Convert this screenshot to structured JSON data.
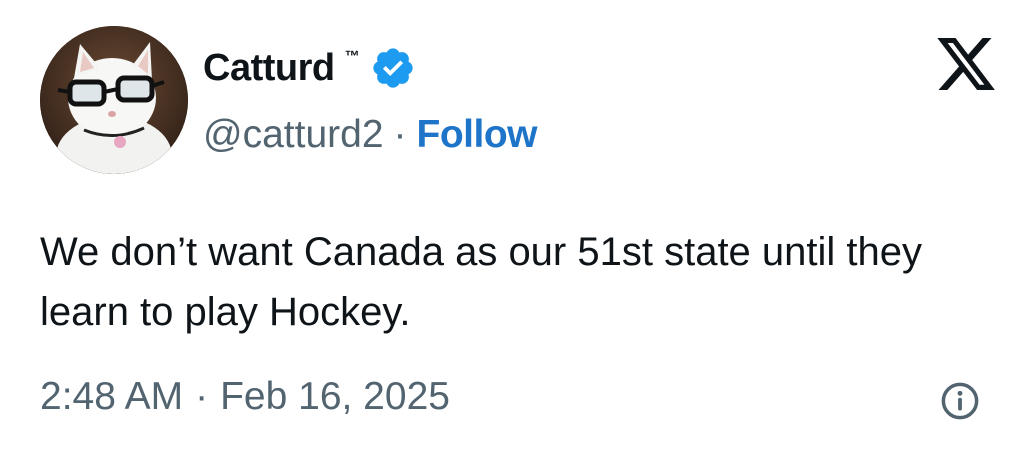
{
  "author": {
    "display_name": "Catturd",
    "name_suffix": "™",
    "handle": "@catturd2",
    "separator": "·",
    "follow_label": "Follow",
    "verified_color": "#1d9bf0"
  },
  "tweet": {
    "text": "We don’t want Canada as our 51st state until they learn to play Hockey.",
    "time": "2:48 AM",
    "separator": "·",
    "date": "Feb 16, 2025"
  },
  "icons": {
    "brand": "x-logo-icon",
    "info": "info-icon",
    "verified": "verified-badge-icon"
  },
  "colors": {
    "text_primary": "#0f1419",
    "text_secondary": "#536471",
    "follow_link": "#1d74c9"
  }
}
